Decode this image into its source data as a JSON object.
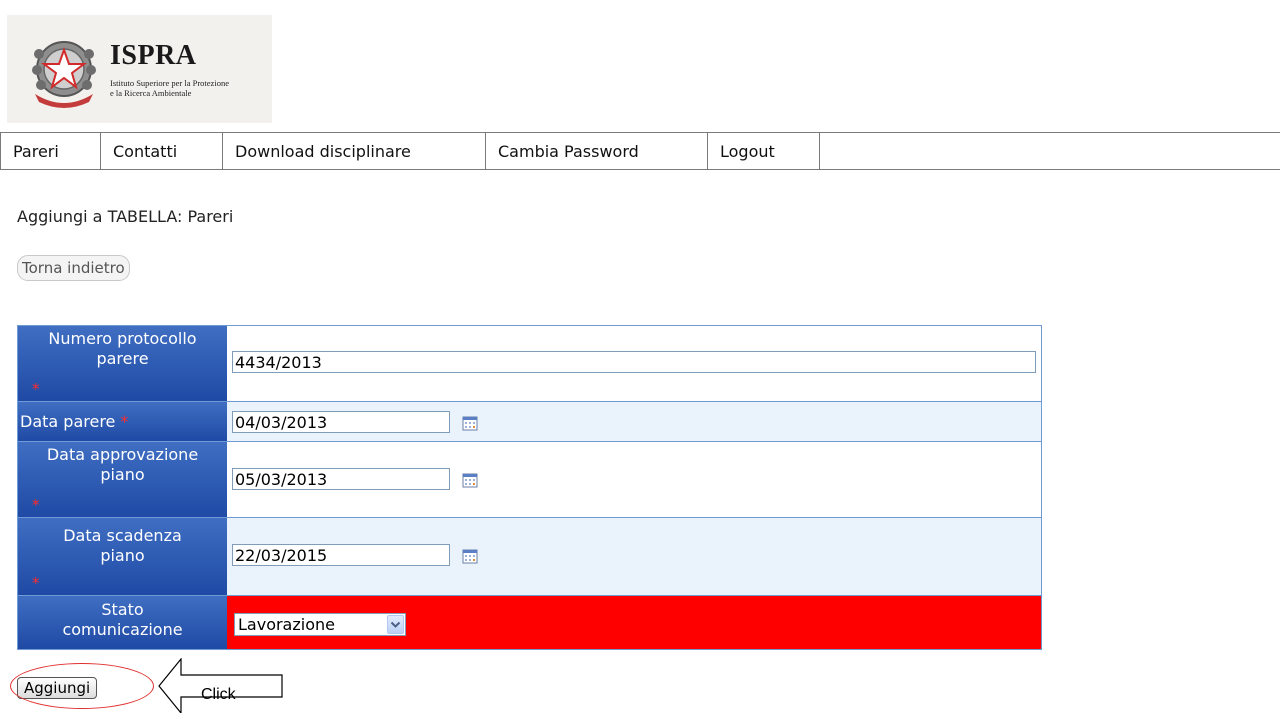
{
  "logo": {
    "name": "ISPRA",
    "subtitle_line1": "Istituto Superiore per la Protezione",
    "subtitle_line2": "e la Ricerca Ambientale"
  },
  "nav": {
    "items": [
      {
        "label": "Pareri"
      },
      {
        "label": "Contatti"
      },
      {
        "label": "Download disciplinare"
      },
      {
        "label": "Cambia Password"
      },
      {
        "label": "Logout"
      }
    ]
  },
  "page": {
    "title": "Aggiungi a TABELLA: Pareri",
    "back_label": "Torna indietro"
  },
  "form": {
    "required_mark": "*",
    "fields": [
      {
        "label_line1": "Numero protocollo",
        "label_line2": "parere",
        "value": "4434/2013"
      },
      {
        "label_line1": "Data parere",
        "label_line2": "",
        "value": "04/03/2013"
      },
      {
        "label_line1": "Data approvazione",
        "label_line2": "piano",
        "value": "05/03/2013"
      },
      {
        "label_line1": "Data scadenza",
        "label_line2": "piano",
        "value": "22/03/2015"
      },
      {
        "label_line1": "Stato",
        "label_line2": "comunicazione",
        "value": "Lavorazione"
      }
    ],
    "status_color": "#ff0000",
    "label_color": "#1f4aa5",
    "add_label": "Aggiungi"
  },
  "annotation": {
    "text": "Click",
    "color": "#e23030"
  },
  "icons": {
    "calendar": "calendar-icon",
    "dropdown": "chevron-down-icon",
    "emblem": "emblem-logo"
  }
}
